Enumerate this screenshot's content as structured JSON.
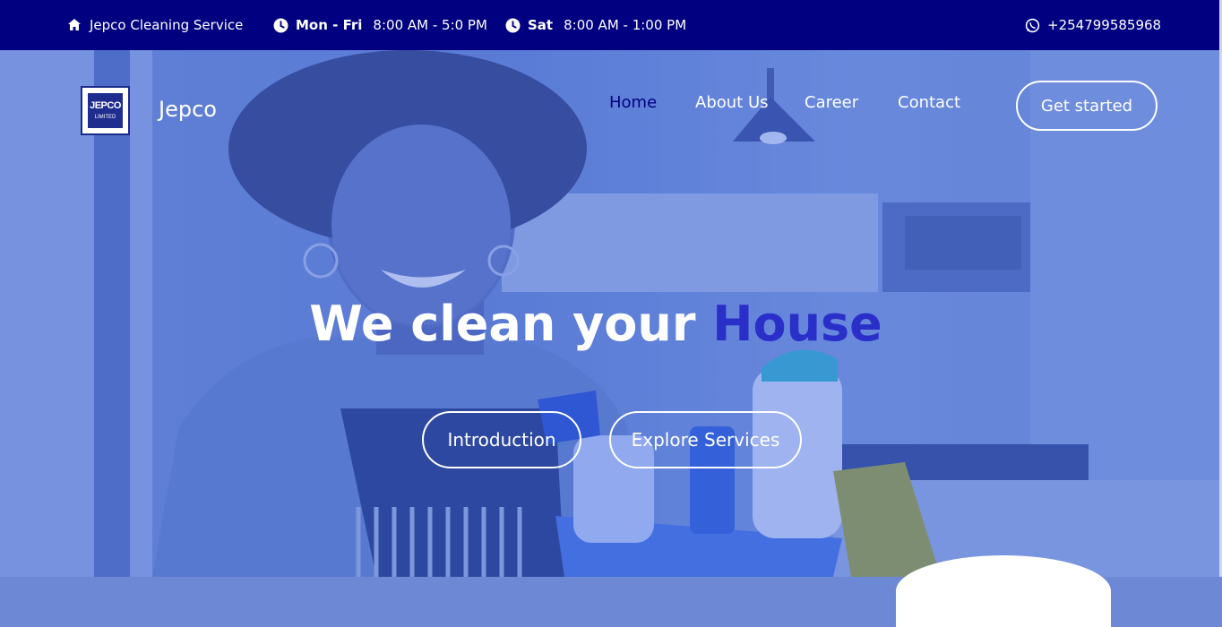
{
  "topbar": {
    "company": "Jepco Cleaning Service",
    "weekday_label": "Mon - Fri",
    "weekday_hours": "8:00 AM - 5:0 PM",
    "saturday_label": "Sat",
    "saturday_hours": "8:00 AM - 1:00 PM",
    "phone": "+254799585968"
  },
  "header": {
    "logo_line1": "JEPCO",
    "logo_line2": "LIMITED",
    "brand": "Jepco",
    "nav": [
      "Home",
      "About Us",
      "Career",
      "Contact"
    ],
    "cta": "Get started"
  },
  "hero": {
    "headline_main": "We clean your",
    "headline_accent": "House",
    "buttons": [
      "Introduction",
      "Explore Services"
    ]
  },
  "colors": {
    "topbar_bg": "#000080",
    "accent": "#2a2fc9",
    "active_nav": "#000080"
  },
  "icons": [
    "home-icon",
    "clock-icon",
    "whatsapp-icon"
  ]
}
